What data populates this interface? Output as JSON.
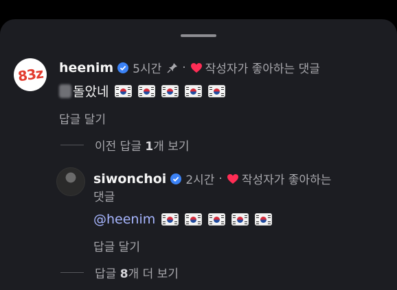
{
  "comment": {
    "avatar_text": "83z",
    "username": "heenim",
    "time": "5시간",
    "separator": "·",
    "liked_label": "작성자가 좋아하는 댓글",
    "text": "돌았네",
    "flags": [
      "kr-flag",
      "kr-flag",
      "kr-flag",
      "kr-flag",
      "kr-flag"
    ],
    "reply_label": "답글 달기",
    "view_previous": {
      "prefix": "이전 답글 ",
      "count": "1",
      "suffix": "개 보기"
    }
  },
  "reply": {
    "username": "siwonchoi",
    "time": "2시간",
    "separator": "·",
    "liked_label_line1": "작성자가 좋아하는",
    "liked_label_line2": "댓글",
    "mention": "@heenim",
    "flags": [
      "kr-flag",
      "kr-flag",
      "kr-flag",
      "kr-flag",
      "kr-flag"
    ],
    "reply_label": "답글 달기",
    "view_more": {
      "prefix": "답글 ",
      "count": "8",
      "suffix": "개 더 보기"
    }
  },
  "colors": {
    "background": "#1c1d22",
    "secondary_text": "#a8a8ad",
    "verified": "#3b82f6",
    "heart": "#ff2d55",
    "mention": "#a7b6ff"
  }
}
